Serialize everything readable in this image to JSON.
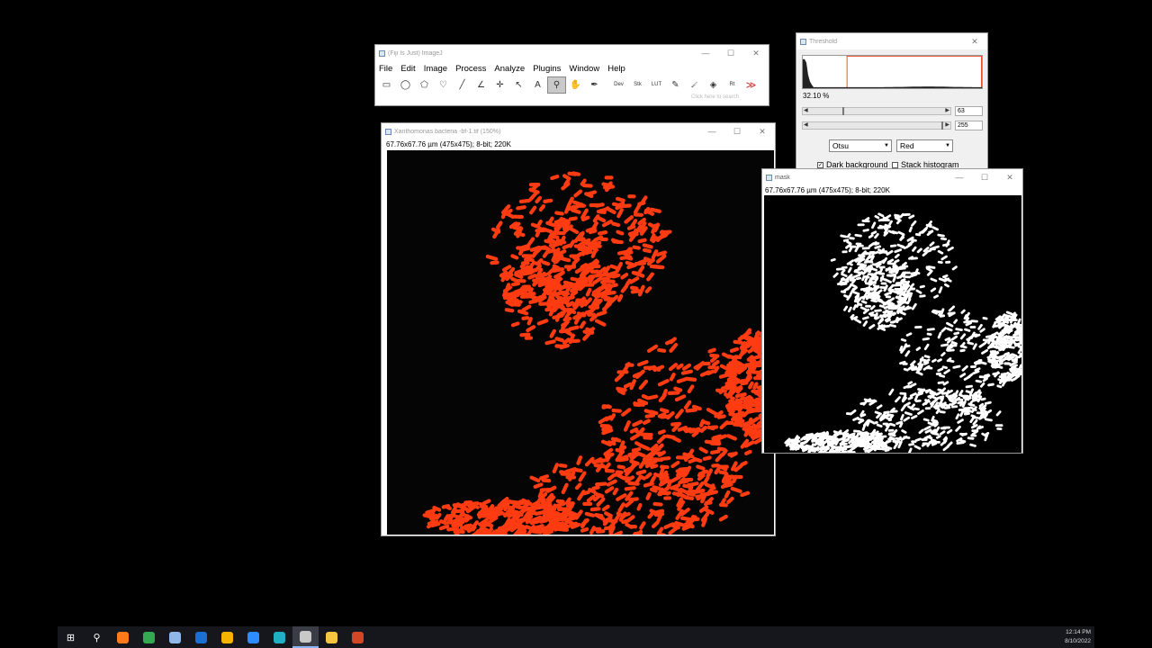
{
  "imagej": {
    "title": "(Fiji Is Just) ImageJ",
    "menu": [
      "File",
      "Edit",
      "Image",
      "Process",
      "Analyze",
      "Plugins",
      "Window",
      "Help"
    ],
    "search_placeholder": "Click here to search",
    "tools": [
      {
        "name": "rectangle-tool",
        "glyph": "▭"
      },
      {
        "name": "oval-tool",
        "glyph": "◯"
      },
      {
        "name": "polygon-tool",
        "glyph": "⬠"
      },
      {
        "name": "freehand-tool",
        "glyph": "♡"
      },
      {
        "name": "line-tool",
        "glyph": "╱"
      },
      {
        "name": "angle-tool",
        "glyph": "∠"
      },
      {
        "name": "point-tool",
        "glyph": "✛"
      },
      {
        "name": "wand-tool",
        "glyph": "↖"
      },
      {
        "name": "text-tool",
        "glyph": "A"
      },
      {
        "name": "magnifier-tool",
        "glyph": "⚲"
      },
      {
        "name": "hand-tool",
        "glyph": "✋"
      },
      {
        "name": "color-picker-tool",
        "glyph": "✒"
      }
    ],
    "extra_tools": [
      {
        "name": "developer-menu-tool",
        "label": "Dev"
      },
      {
        "name": "stacks-menu-tool",
        "label": "Stk"
      },
      {
        "name": "lut-menu-tool",
        "label": "LUT"
      },
      {
        "name": "pencil-tool",
        "label": "✎"
      },
      {
        "name": "brush-tool",
        "label": "🖌"
      },
      {
        "name": "flood-fill-tool",
        "label": "◈"
      },
      {
        "name": "roi-manager-tool",
        "label": "Rt"
      },
      {
        "name": "more-tools-button",
        "label": "≫"
      }
    ]
  },
  "threshold": {
    "title": "Threshold",
    "percent": "32.10 %",
    "min_value": "63",
    "max_value": "255",
    "min_fraction": 0.247,
    "max_fraction": 1.0,
    "method": "Otsu",
    "display": "Red",
    "dark_background_label": "Dark background",
    "dark_background_checked": true,
    "stack_histogram_label": "Stack histogram",
    "stack_histogram_checked": false,
    "accent": "#e8552c"
  },
  "image_window": {
    "title": "Xanthomonas bacteria -bf-1.tif (150%)",
    "info": "67.76x67.76 µm (475x475); 8-bit; 220K",
    "overlay_color": "#ff3b12"
  },
  "mask_window": {
    "title": "mask",
    "info": "67.76x67.76 µm (475x475); 8-bit; 220K"
  },
  "taskbar": {
    "apps": [
      {
        "name": "start-button-icon",
        "glyph": "⊞",
        "color": "#ffffff"
      },
      {
        "name": "search-icon",
        "glyph": "⚲",
        "color": "#ffffff"
      },
      {
        "name": "firefox-icon",
        "glyph": "",
        "color": "#ff7a1a"
      },
      {
        "name": "chrome-icon",
        "glyph": "",
        "color": "#34a853"
      },
      {
        "name": "notepad-icon",
        "glyph": "",
        "color": "#8fb8e8"
      },
      {
        "name": "outlook-icon",
        "glyph": "",
        "color": "#1a6fd1"
      },
      {
        "name": "chrome-profile-icon",
        "glyph": "",
        "color": "#f4b400"
      },
      {
        "name": "zoom-icon",
        "glyph": "",
        "color": "#2d8cff"
      },
      {
        "name": "edge-icon",
        "glyph": "",
        "color": "#1fb0c2"
      },
      {
        "name": "fiji-icon",
        "glyph": "",
        "color": "#c8c8c8"
      },
      {
        "name": "file-explorer-icon",
        "glyph": "",
        "color": "#f5c542"
      },
      {
        "name": "powerpoint-icon",
        "glyph": "",
        "color": "#d24726"
      }
    ],
    "active_app": "fiji-icon",
    "time": "12:14 PM",
    "date": "8/10/2022"
  }
}
